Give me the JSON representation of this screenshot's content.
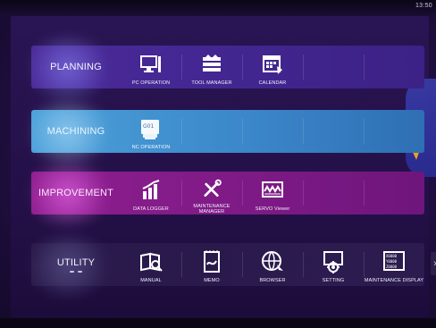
{
  "status": {
    "clock_text": "13:50"
  },
  "rows": {
    "planning": {
      "label": "PLANNING",
      "items": [
        {
          "label": "PC OPERATION",
          "icon": "pc-monitor-icon"
        },
        {
          "label": "TOOL MANAGER",
          "icon": "tool-manager-icon"
        },
        {
          "label": "CALENDAR",
          "icon": "calendar-icon"
        }
      ]
    },
    "machining": {
      "label": "MACHINING",
      "items": [
        {
          "label": "NC OPERATION",
          "icon": "nc-operation-icon",
          "badge": "G01"
        }
      ]
    },
    "improvement": {
      "label": "IMPROVEMENT",
      "items": [
        {
          "label": "DATA LOGGER",
          "icon": "data-logger-icon"
        },
        {
          "label": "MAINTENANCE MANAGER",
          "icon": "wrench-screwdriver-icon"
        },
        {
          "label": "SERVO Viewer",
          "icon": "servo-viewer-icon"
        }
      ]
    },
    "utility": {
      "label": "UTILITY",
      "items": [
        {
          "label": "MANUAL",
          "icon": "manual-book-icon"
        },
        {
          "label": "MEMO",
          "icon": "memo-icon"
        },
        {
          "label": "BROWSER",
          "icon": "browser-globe-icon"
        },
        {
          "label": "SETTING",
          "icon": "settings-gear-icon"
        },
        {
          "label": "MAINTENANCE DISPLAY",
          "icon": "maintenance-display-icon",
          "display_digits": [
            "X0000",
            "Y0000",
            "Z0000"
          ]
        }
      ]
    }
  },
  "nav": {
    "next_arrow": "›"
  },
  "theme": {
    "planning": "#4b2a98",
    "machining": "#3b87c9",
    "improvement": "#8e1e8e",
    "utility": "#2a1a4a",
    "accent_orange": "#f2a21a"
  }
}
